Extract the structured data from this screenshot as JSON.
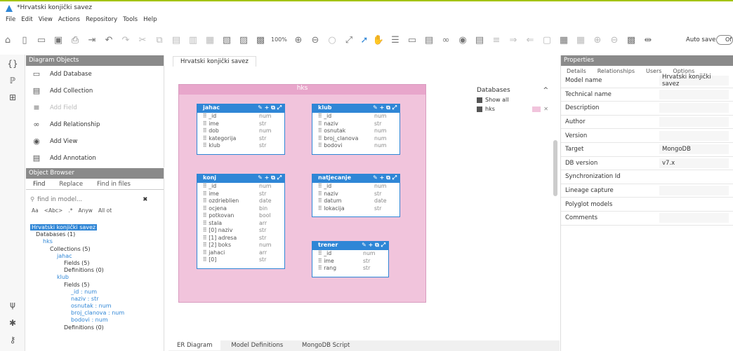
{
  "window": {
    "title": "*Hrvatski konjički savez"
  },
  "menu": [
    "File",
    "Edit",
    "View",
    "Actions",
    "Repository",
    "Tools",
    "Help"
  ],
  "toolbar": {
    "zoom": "100%",
    "autosave": "Auto save",
    "autosave_state": "Of"
  },
  "diagram_objects": {
    "title": "Diagram Objects",
    "items": [
      "Add Database",
      "Add Collection",
      "Add Field",
      "Add Relationship",
      "Add View",
      "Add Annotation"
    ]
  },
  "object_browser": {
    "title": "Object Browser",
    "tabs": [
      "Find",
      "Replace",
      "Find in files"
    ],
    "search_placeholder": "find in model...",
    "opt1": "Aa",
    "opt2": "<Abc>",
    "opt3": ".*",
    "opt4": "Anyw",
    "opt5": "All ot"
  },
  "tree": {
    "root": "Hrvatski konjički savez",
    "databases": "Databases (1)",
    "hks": "hks",
    "collections": "Collections (5)",
    "jahac": "jahac",
    "fields5": "Fields (5)",
    "defs0": "Definitions (0)",
    "klub": "klub",
    "fields5b": "Fields (5)",
    "kf1": "_id : num",
    "kf2": "naziv : str",
    "kf3": "osnutak : num",
    "kf4": "broj_clanova : num",
    "kf5": "bodovi : num",
    "defs0b": "Definitions (0)"
  },
  "editor": {
    "tab": "Hrvatski konjički savez",
    "db_name": "hks"
  },
  "databases_panel": {
    "title": "Databases",
    "show_all": "Show all",
    "hks": "hks"
  },
  "collections": {
    "jahac": {
      "name": "jahac",
      "fields": [
        [
          "_id",
          "num"
        ],
        [
          "ime",
          "str"
        ],
        [
          "dob",
          "num"
        ],
        [
          "kategorija",
          "str"
        ],
        [
          "klub",
          "str"
        ]
      ]
    },
    "klub": {
      "name": "klub",
      "fields": [
        [
          "_id",
          "num"
        ],
        [
          "naziv",
          "str"
        ],
        [
          "osnutak",
          "num"
        ],
        [
          "broj_clanova",
          "num"
        ],
        [
          "bodovi",
          "num"
        ]
      ]
    },
    "konj": {
      "name": "konj",
      "fields": [
        [
          "_id",
          "num"
        ],
        [
          "ime",
          "str"
        ],
        [
          "ozdrieblien",
          "date"
        ],
        [
          "ocjena",
          "bin"
        ],
        [
          "potkovan",
          "bool"
        ],
        [
          "stala",
          "arr"
        ],
        [
          "[0] naziv",
          "str"
        ],
        [
          "[1] adresa",
          "str"
        ],
        [
          "[2] boks",
          "num"
        ],
        [
          "jahaci",
          "arr"
        ],
        [
          "[0]",
          "str"
        ]
      ]
    },
    "natjecanje": {
      "name": "natjecanje",
      "fields": [
        [
          "_id",
          "num"
        ],
        [
          "naziv",
          "str"
        ],
        [
          "datum",
          "date"
        ],
        [
          "lokacija",
          "str"
        ]
      ]
    },
    "trener": {
      "name": "trener",
      "fields": [
        [
          "_id",
          "num"
        ],
        [
          "ime",
          "str"
        ],
        [
          "rang",
          "str"
        ]
      ]
    }
  },
  "bottom_tabs": [
    "ER Diagram",
    "Model Definitions",
    "MongoDB Script"
  ],
  "properties": {
    "title": "Properties",
    "tabs": [
      "Details",
      "Relationships",
      "Users",
      "Options"
    ],
    "rows": [
      [
        "Model name",
        "Hrvatski konjički savez"
      ],
      [
        "Technical name",
        ""
      ],
      [
        "Description",
        ""
      ],
      [
        "Author",
        ""
      ],
      [
        "Version",
        ""
      ],
      [
        "Target",
        "MongoDB"
      ],
      [
        "DB version",
        "v7.x"
      ],
      [
        "Synchronization Id",
        ""
      ],
      [
        "Lineage capture",
        ""
      ],
      [
        "Polyglot models",
        ""
      ],
      [
        "Comments",
        ""
      ]
    ]
  }
}
